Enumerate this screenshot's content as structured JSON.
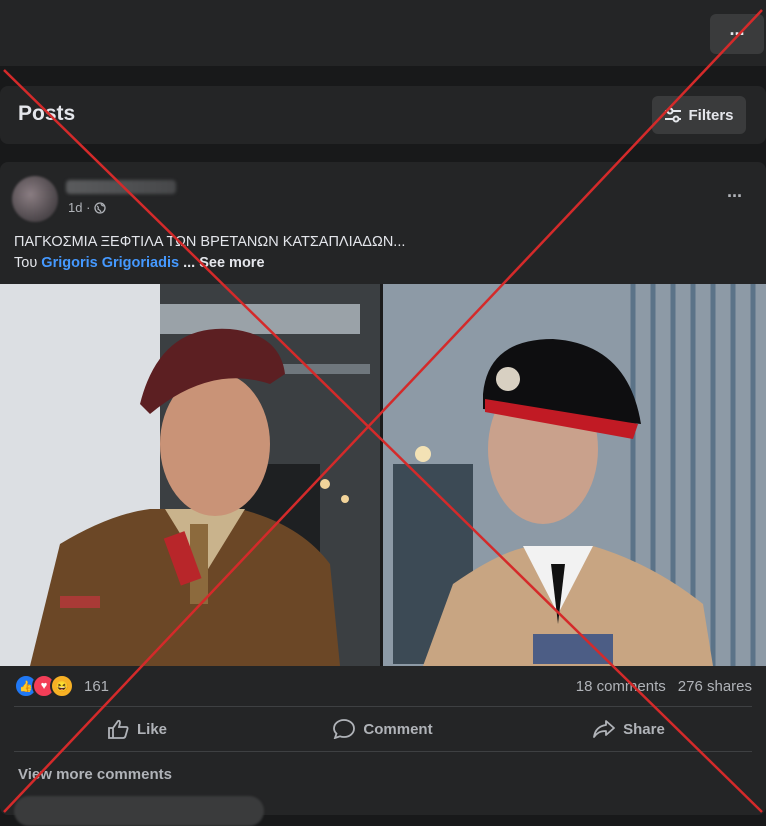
{
  "topbar": {
    "more_label": "···"
  },
  "posts_section": {
    "title": "Posts",
    "filters_label": "Filters"
  },
  "post": {
    "time": "1d ·",
    "more_label": "···",
    "text_line1": "ΠΑΓΚΟΣΜΙΑ ΞΕΦΤΙΛΑ ΤΩΝ ΒΡΕΤΑΝΩΝ ΚΑΤΣΑΠΛΙΑΔΩΝ...",
    "text_prefix": "Του",
    "text_link": "Grigoris Grigoriadis",
    "see_more": "... See more",
    "reaction_count": "161",
    "comments": "18 comments",
    "shares": "276 shares",
    "actions": {
      "like": "Like",
      "comment": "Comment",
      "share": "Share"
    },
    "view_more_comments": "View more comments"
  },
  "colors": {
    "background": "#18191a",
    "card": "#242526",
    "link": "#4599ff",
    "cross": "#d42a2a"
  }
}
